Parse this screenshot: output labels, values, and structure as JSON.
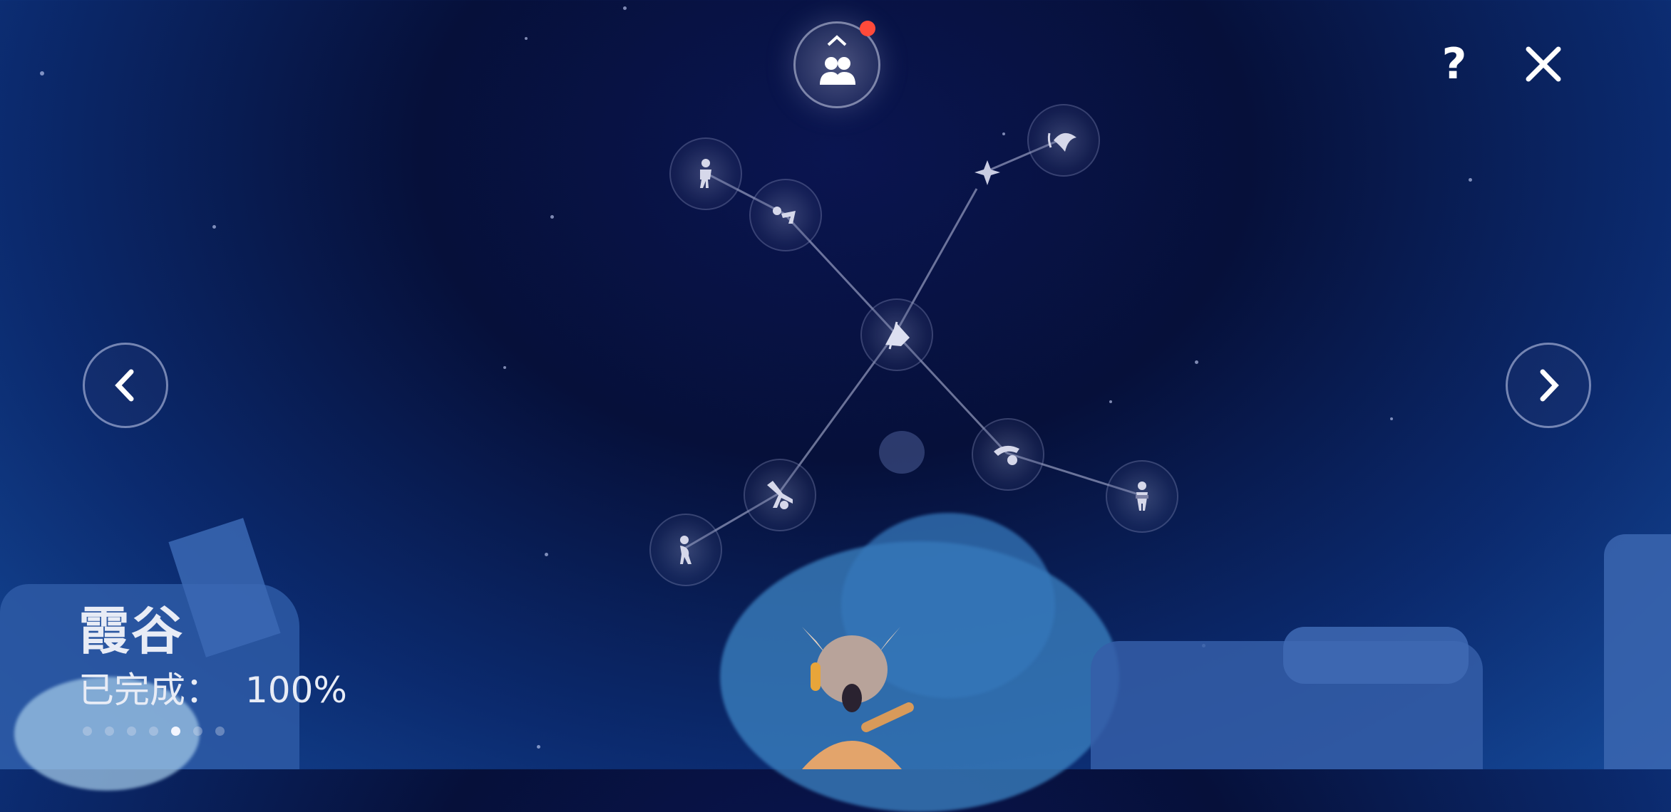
{
  "area": {
    "name": "霞谷",
    "progress_label": "已完成：",
    "progress_value": "100%"
  },
  "top_button": {
    "icon": "friends-icon",
    "has_notification": true,
    "notification_color": "#ff4a3a"
  },
  "help_label": "?",
  "page_indicator": {
    "total": 7,
    "active_index": 4
  },
  "constellation": {
    "center": "cape-icon",
    "nodes": [
      "stand-pose-icon",
      "bow-icon",
      "dolphin-dive-icon",
      "dancing-pose-icon",
      "cartwheel-icon",
      "float-pose-icon",
      "crossed-arms-icon"
    ]
  },
  "colors": {
    "sky_top": "#06103a",
    "sky_bottom": "#154a9a",
    "accent_red": "#ff4a3a"
  }
}
